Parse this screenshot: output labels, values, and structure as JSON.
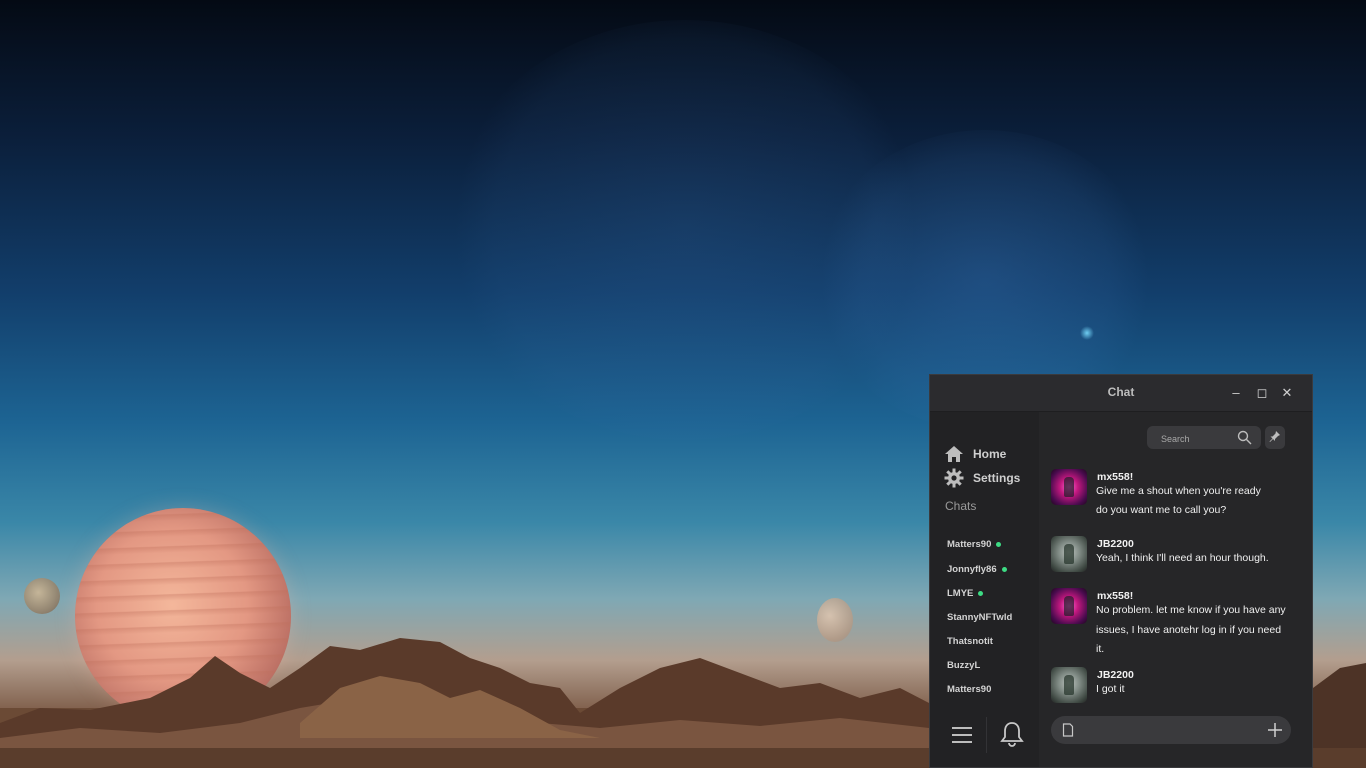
{
  "window": {
    "title": "Chat",
    "minimize": "–",
    "maximize": "◻",
    "close": "✕"
  },
  "sidebar": {
    "nav": [
      {
        "label": "Home",
        "icon": "home-icon"
      },
      {
        "label": "Settings",
        "icon": "gear-icon"
      }
    ],
    "chats_heading": "Chats",
    "contacts": [
      {
        "name": "Matters90",
        "online": true
      },
      {
        "name": "Jonnyfly86",
        "online": true
      },
      {
        "name": "LMYE",
        "online": true
      },
      {
        "name": "StannyNFTwld",
        "online": false
      },
      {
        "name": "Thatsnotit",
        "online": false
      },
      {
        "name": "BuzzyL",
        "online": false
      },
      {
        "name": "Matters90",
        "online": false
      }
    ],
    "bottom_icons": [
      "hamburger-menu-icon",
      "bell-icon"
    ]
  },
  "search": {
    "placeholder": "Search"
  },
  "messages": [
    {
      "user": "mx558!",
      "avatar": "pink",
      "lines": [
        "Give me a shout when you're ready",
        "do you want me to call you?"
      ]
    },
    {
      "user": "JB2200",
      "avatar": "gray",
      "lines": [
        "Yeah, I think I'll need an hour though."
      ]
    },
    {
      "user": "mx558!",
      "avatar": "pink",
      "lines": [
        "No problem. let me know if you have any",
        "issues, I have anotehr log in if you need",
        "it."
      ]
    },
    {
      "user": "JB2200",
      "avatar": "gray",
      "lines": [
        "I got it"
      ]
    }
  ],
  "composer": {
    "placeholder": ""
  },
  "colors": {
    "online": "#3ddc84",
    "window_bg": "#262628",
    "sidebar_bg": "#222224"
  }
}
